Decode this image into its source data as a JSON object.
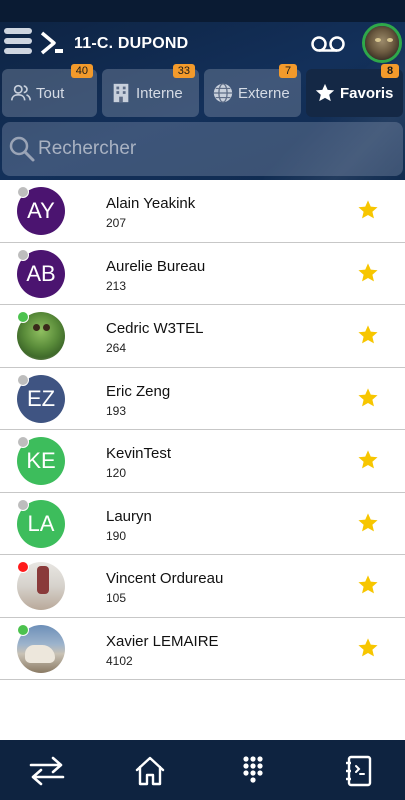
{
  "header": {
    "account_name": "11-C. DUPOND"
  },
  "tabs": [
    {
      "label": "Tout",
      "badge": "40",
      "icon": "people-icon"
    },
    {
      "label": "Interne",
      "badge": "33",
      "icon": "building-icon"
    },
    {
      "label": "Externe",
      "badge": "7",
      "icon": "globe-icon"
    },
    {
      "label": "Favoris",
      "badge": "8",
      "icon": "star-icon"
    }
  ],
  "search": {
    "placeholder": "Rechercher",
    "value": ""
  },
  "colors": {
    "header_bg": "#0d2240",
    "badge": "#f39a2b",
    "star": "#f7c600",
    "presence_online": "#4cc24e",
    "presence_offline": "#bdbdbd",
    "presence_busy": "#ff1a1a"
  },
  "contacts": [
    {
      "initials": "AY",
      "name": "Alain Yeakink",
      "ext": "207",
      "avatar_color": "#4b1470",
      "presence": "offline"
    },
    {
      "initials": "AB",
      "name": "Aurelie Bureau",
      "ext": "213",
      "avatar_color": "#4b1470",
      "presence": "offline"
    },
    {
      "initials": "",
      "name": "Cedric W3TEL",
      "ext": "264",
      "avatar_color": "",
      "presence": "online"
    },
    {
      "initials": "EZ",
      "name": "Eric Zeng",
      "ext": "193",
      "avatar_color": "#3f5482",
      "presence": "offline"
    },
    {
      "initials": "KE",
      "name": "KevinTest",
      "ext": "120",
      "avatar_color": "#3dbd5c",
      "presence": "offline"
    },
    {
      "initials": "LA",
      "name": "Lauryn",
      "ext": "190",
      "avatar_color": "#3dbd5c",
      "presence": "offline"
    },
    {
      "initials": "",
      "name": "Vincent Ordureau",
      "ext": "105",
      "avatar_color": "",
      "presence": "busy"
    },
    {
      "initials": "",
      "name": "Xavier LEMAIRE",
      "ext": "4102",
      "avatar_color": "",
      "presence": "online"
    }
  ],
  "bottom_nav": [
    "transfer-icon",
    "home-icon",
    "dialpad-icon",
    "contacts-book-icon"
  ]
}
